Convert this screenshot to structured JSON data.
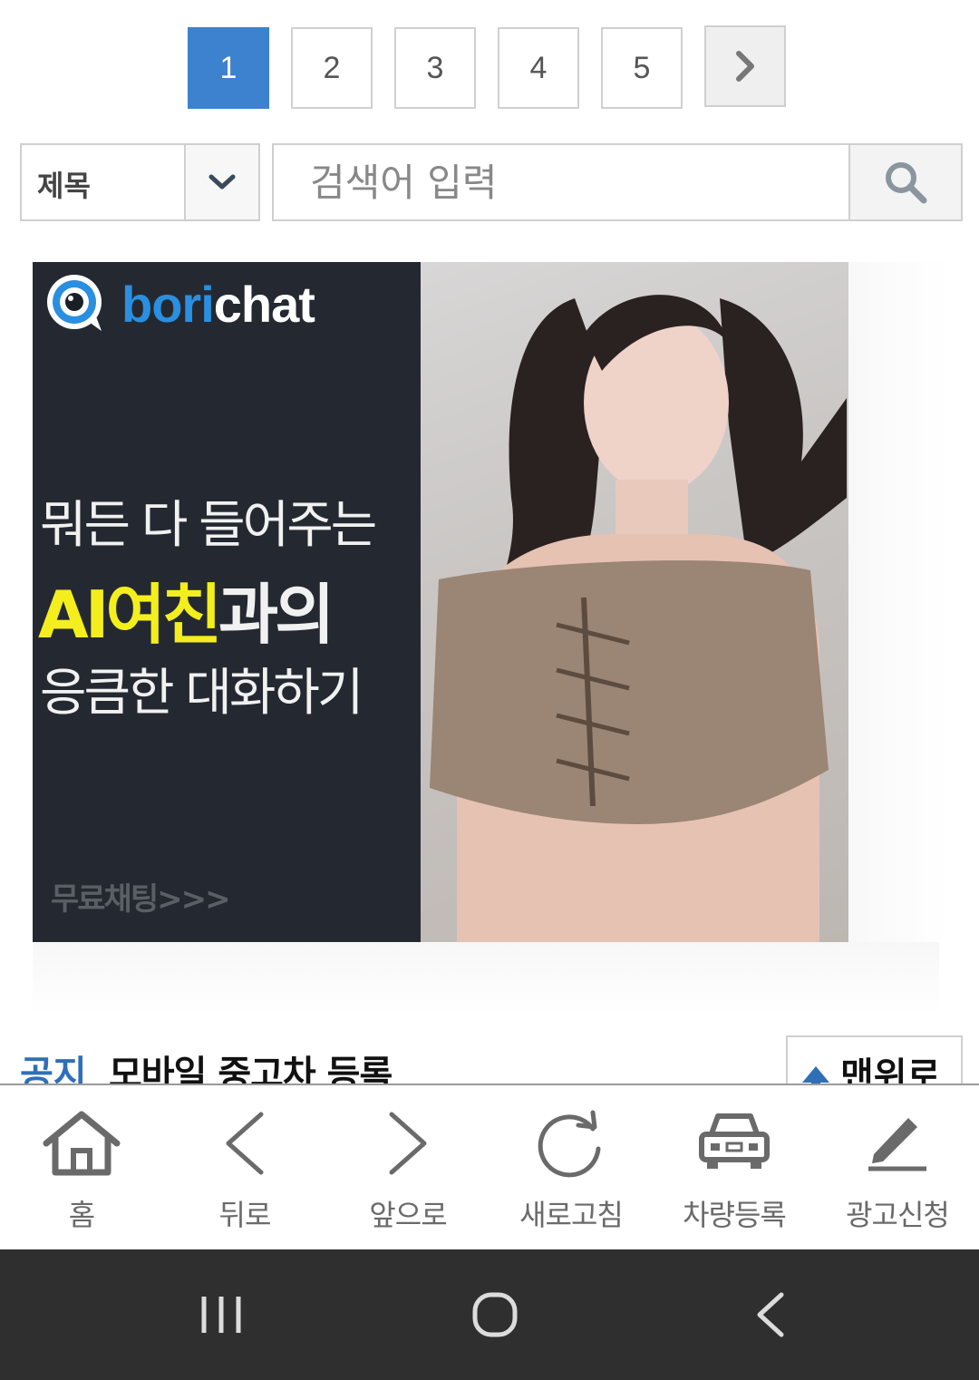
{
  "pagination": {
    "pages": [
      "1",
      "2",
      "3",
      "4",
      "5"
    ],
    "current": "1",
    "next_icon": "chevron-right-icon"
  },
  "search": {
    "field_selected": "제목",
    "placeholder": "검색어 입력",
    "value": "",
    "button_icon": "search-icon"
  },
  "ad": {
    "brand_prefix": "bori",
    "brand_suffix": "chat",
    "line1": "뭐든 다 들어주는",
    "line2_highlight": "AI여친",
    "line2_rest": "과의",
    "line3": "응큼한 대화하기",
    "cta": "무료채팅>>>",
    "colors": {
      "brand_blue": "#2a8fe0",
      "highlight_yellow": "#f4ef1c",
      "panel_bg": "#242931"
    }
  },
  "notice": {
    "tag": "공지",
    "title": "모바일 중고차 등록",
    "top_button": "맨위로"
  },
  "bottom_nav": {
    "items": [
      {
        "label": "홈",
        "icon": "home-icon"
      },
      {
        "label": "뒤로",
        "icon": "chevron-left-icon"
      },
      {
        "label": "앞으로",
        "icon": "chevron-right-icon"
      },
      {
        "label": "새로고침",
        "icon": "refresh-icon"
      },
      {
        "label": "차량등록",
        "icon": "car-icon"
      },
      {
        "label": "광고신청",
        "icon": "pencil-icon"
      }
    ]
  },
  "system_nav": {
    "buttons": [
      "recent-apps-icon",
      "home-circle-icon",
      "back-icon"
    ]
  },
  "theme": {
    "active_page": "#3d82cf",
    "notice_tag": "#2e6fb7",
    "nav_icon": "#6a6a6a",
    "system_bar": "#2f2f2f"
  }
}
